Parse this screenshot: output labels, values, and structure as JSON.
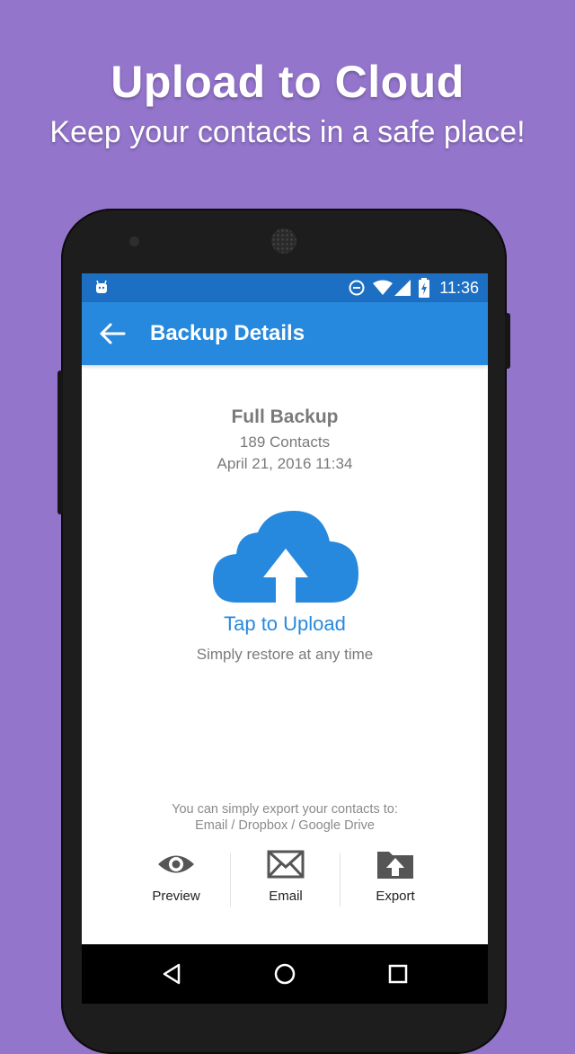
{
  "promo": {
    "title": "Upload to Cloud",
    "subtitle": "Keep your contacts in a safe place!"
  },
  "status_bar": {
    "time": "11:36",
    "icons": [
      "android-notification-icon",
      "data-saver-icon",
      "wifi-icon",
      "signal-icon",
      "battery-charging-icon"
    ]
  },
  "app_bar": {
    "title": "Backup Details",
    "back_icon": "arrow-left-icon"
  },
  "backup": {
    "name": "Full Backup",
    "contacts": "189 Contacts",
    "date": "April 21, 2016 11:34"
  },
  "upload": {
    "icon": "cloud-upload-icon",
    "label": "Tap to Upload",
    "hint": "Simply restore at any time"
  },
  "export": {
    "hint_line1": "You can simply export your contacts to:",
    "hint_line2": "Email / Dropbox / Google Drive",
    "actions": [
      {
        "label": "Preview",
        "icon": "eye-icon"
      },
      {
        "label": "Email",
        "icon": "envelope-icon"
      },
      {
        "label": "Export",
        "icon": "folder-upload-icon"
      }
    ]
  },
  "nav_bar": {
    "icons": [
      "back-triangle-icon",
      "home-circle-icon",
      "recents-square-icon"
    ]
  },
  "colors": {
    "background": "#9475cc",
    "accent": "#2789dd",
    "status_bar": "#1d6fc3"
  }
}
